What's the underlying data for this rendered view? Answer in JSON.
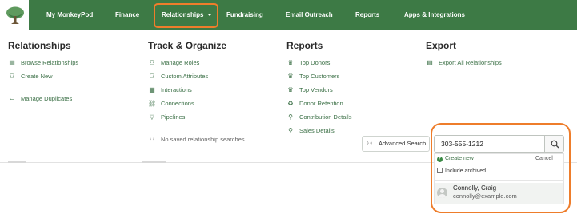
{
  "nav": {
    "items": [
      {
        "label": "My MonkeyPod"
      },
      {
        "label": "Finance"
      },
      {
        "label": "Relationships"
      },
      {
        "label": "Fundraising"
      },
      {
        "label": "Email Outreach"
      },
      {
        "label": "Reports"
      },
      {
        "label": "Apps & Integrations"
      }
    ],
    "active": "Relationships"
  },
  "menu": {
    "relationships": {
      "heading": "Relationships",
      "links": [
        {
          "label": "Browse Relationships",
          "icon": "list-icon"
        },
        {
          "label": "Create New",
          "icon": "add-person-icon"
        },
        {
          "label": "Manage Duplicates",
          "icon": "merge-icon"
        }
      ]
    },
    "track": {
      "heading": "Track & Organize",
      "links": [
        {
          "label": "Manage Roles",
          "icon": "roles-icon"
        },
        {
          "label": "Custom Attributes",
          "icon": "attributes-icon"
        },
        {
          "label": "Interactions",
          "icon": "calendar-icon"
        },
        {
          "label": "Connections",
          "icon": "connections-icon"
        },
        {
          "label": "Pipelines",
          "icon": "filter-icon"
        }
      ],
      "empty_saved": "No saved relationship searches"
    },
    "reports": {
      "heading": "Reports",
      "links": [
        {
          "label": "Top Donors",
          "icon": "trophy-icon"
        },
        {
          "label": "Top Customers",
          "icon": "trophy-icon"
        },
        {
          "label": "Top Vendors",
          "icon": "trophy-icon"
        },
        {
          "label": "Donor Retention",
          "icon": "recycle-icon"
        },
        {
          "label": "Contribution Details",
          "icon": "search-icon"
        },
        {
          "label": "Sales Details",
          "icon": "search-icon"
        }
      ]
    },
    "export": {
      "heading": "Export",
      "links": [
        {
          "label": "Export All Relationships",
          "icon": "export-icon"
        }
      ]
    }
  },
  "advanced_search": {
    "label": "Advanced Search"
  },
  "search": {
    "value": "303-555-1212",
    "create_new": "Create new",
    "cancel": "Cancel",
    "include_archived": "Include archived",
    "results": [
      {
        "name": "Connolly, Craig",
        "email": "connolly@example.com"
      }
    ]
  },
  "colors": {
    "brand_green": "#3d7a45",
    "highlight_orange": "#ee7d2b",
    "link_green": "#3a6f45"
  }
}
